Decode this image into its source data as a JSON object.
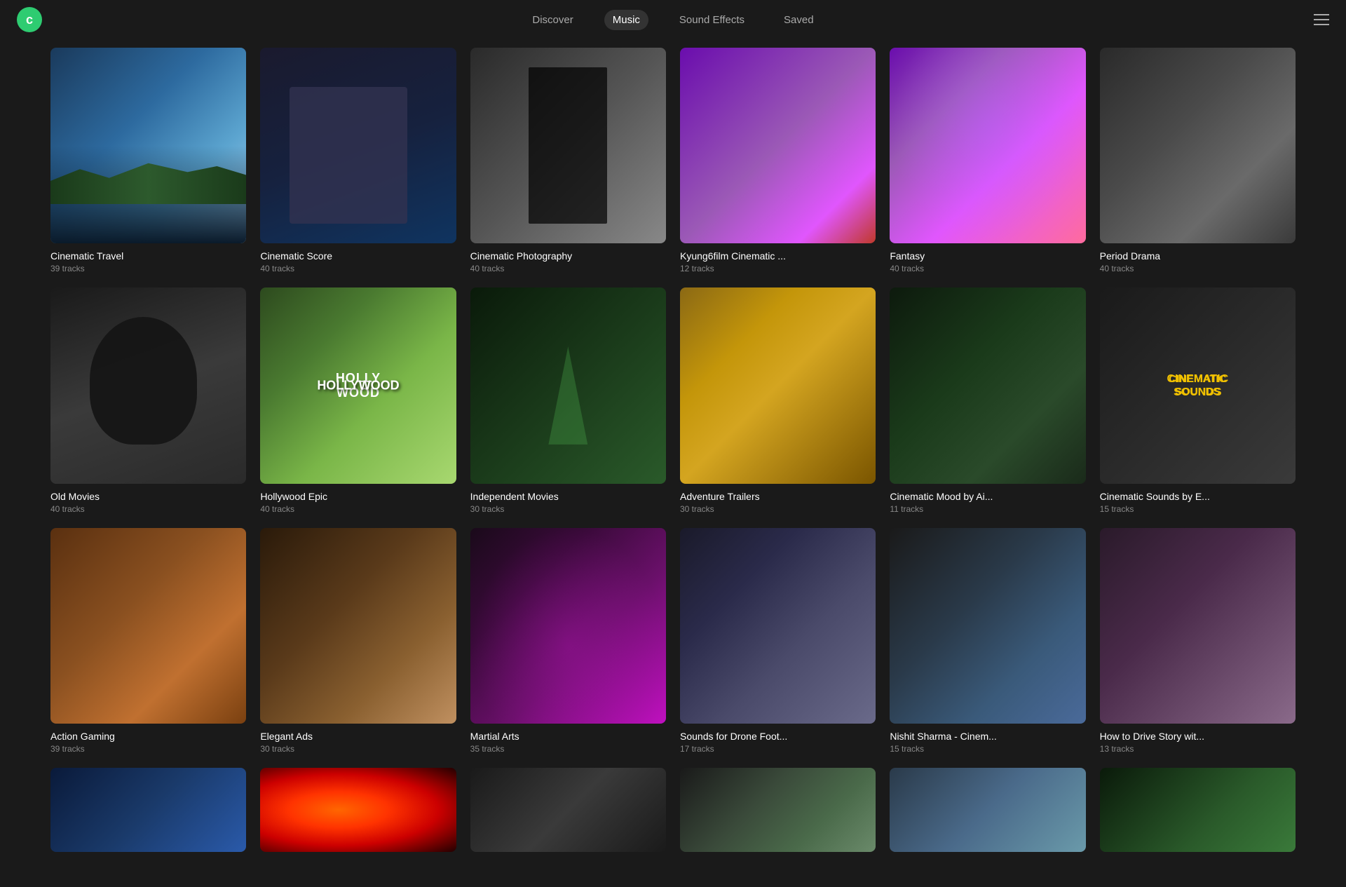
{
  "app": {
    "logo_text": "c"
  },
  "nav": {
    "items": [
      {
        "id": "discover",
        "label": "Discover",
        "active": false
      },
      {
        "id": "music",
        "label": "Music",
        "active": true
      },
      {
        "id": "sound-effects",
        "label": "Sound Effects",
        "active": false
      },
      {
        "id": "saved",
        "label": "Saved",
        "active": false
      }
    ]
  },
  "rows": [
    {
      "id": "row1",
      "cards": [
        {
          "id": "cinematic-travel",
          "title": "Cinematic Travel",
          "tracks": "39 tracks",
          "thumb_class": "thumb-cinematic-travel"
        },
        {
          "id": "cinematic-score",
          "title": "Cinematic Score",
          "tracks": "40 tracks",
          "thumb_class": "thumb-cinematic-score"
        },
        {
          "id": "cinematic-photography",
          "title": "Cinematic Photography",
          "tracks": "40 tracks",
          "thumb_class": "thumb-cinematic-photo"
        },
        {
          "id": "kyung6film",
          "title": "Kyung6film Cinematic ...",
          "tracks": "12 tracks",
          "thumb_class": "thumb-kyung6film"
        },
        {
          "id": "fantasy",
          "title": "Fantasy",
          "tracks": "40 tracks",
          "thumb_class": "thumb-fantasy"
        },
        {
          "id": "period-drama",
          "title": "Period Drama",
          "tracks": "40 tracks",
          "thumb_class": "thumb-period-drama"
        }
      ]
    },
    {
      "id": "row2",
      "cards": [
        {
          "id": "old-movies",
          "title": "Old Movies",
          "tracks": "40 tracks",
          "thumb_class": "thumb-old-movies"
        },
        {
          "id": "hollywood-epic",
          "title": "Hollywood Epic",
          "tracks": "40 tracks",
          "thumb_class": "thumb-hollywood-epic"
        },
        {
          "id": "independent-movies",
          "title": "Independent Movies",
          "tracks": "30 tracks",
          "thumb_class": "thumb-independent-movies"
        },
        {
          "id": "adventure-trailers",
          "title": "Adventure Trailers",
          "tracks": "30 tracks",
          "thumb_class": "thumb-adventure-trailers"
        },
        {
          "id": "cinematic-mood",
          "title": "Cinematic Mood by Ai...",
          "tracks": "11 tracks",
          "thumb_class": "thumb-cinematic-mood"
        },
        {
          "id": "cinematic-sounds",
          "title": "Cinematic Sounds by E...",
          "tracks": "15 tracks",
          "thumb_class": "thumb-cinematic-sounds"
        }
      ]
    },
    {
      "id": "row3",
      "cards": [
        {
          "id": "action-gaming",
          "title": "Action Gaming",
          "tracks": "39 tracks",
          "thumb_class": "thumb-action-gaming"
        },
        {
          "id": "elegant-ads",
          "title": "Elegant Ads",
          "tracks": "30 tracks",
          "thumb_class": "thumb-elegant-ads"
        },
        {
          "id": "martial-arts",
          "title": "Martial Arts",
          "tracks": "35 tracks",
          "thumb_class": "thumb-martial-arts"
        },
        {
          "id": "sounds-drone",
          "title": "Sounds for Drone Foot...",
          "tracks": "17 tracks",
          "thumb_class": "thumb-sounds-drone"
        },
        {
          "id": "nishit-sharma",
          "title": "Nishit Sharma - Cinem...",
          "tracks": "15 tracks",
          "thumb_class": "thumb-nishit-sharma"
        },
        {
          "id": "how-to-drive",
          "title": "How to Drive Story wit...",
          "tracks": "13 tracks",
          "thumb_class": "thumb-how-to-drive"
        }
      ]
    },
    {
      "id": "row4",
      "cards": [
        {
          "id": "spin-globe",
          "title": "",
          "tracks": "",
          "thumb_class": "thumb-spin-globe"
        },
        {
          "id": "bokeh",
          "title": "",
          "tracks": "",
          "thumb_class": "thumb-bokeh"
        },
        {
          "id": "face",
          "title": "",
          "tracks": "",
          "thumb_class": "thumb-face"
        },
        {
          "id": "road",
          "title": "",
          "tracks": "",
          "thumb_class": "thumb-road"
        },
        {
          "id": "drone2",
          "title": "",
          "tracks": "",
          "thumb_class": "thumb-drone2"
        },
        {
          "id": "forest",
          "title": "",
          "tracks": "",
          "thumb_class": "thumb-forest"
        }
      ]
    }
  ]
}
